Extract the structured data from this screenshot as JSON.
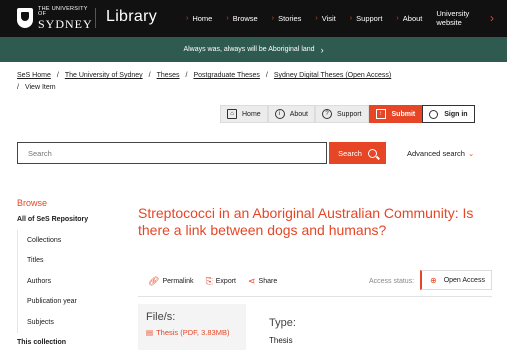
{
  "header": {
    "logo_small": "THE UNIVERSITY OF",
    "logo_big": "SYDNEY",
    "site_title": "Library",
    "nav": [
      "Home",
      "Browse",
      "Stories",
      "Visit",
      "Support",
      "About",
      "University website"
    ]
  },
  "banner": {
    "text": "Always was, always will be Aboriginal land"
  },
  "breadcrumb": [
    "SeS Home",
    "The University of Sydney",
    "Theses",
    "Postgraduate Theses",
    "Sydney Digital Theses (Open Access)",
    "View Item"
  ],
  "utility": {
    "home": "Home",
    "about": "About",
    "support": "Support",
    "submit": "Submit",
    "signin": "Sign in"
  },
  "search": {
    "placeholder": "Search",
    "button": "Search",
    "advanced": "Advanced search"
  },
  "sidebar": {
    "heading": "Browse",
    "group1": "All of SeS Repository",
    "items": [
      "Collections",
      "Titles",
      "Authors",
      "Publication year",
      "Subjects"
    ],
    "group2": "This collection"
  },
  "item": {
    "title": "Streptococci in an Aboriginal Australian Community: Is there a link between dogs and humans?",
    "actions": {
      "permalink": "Permalink",
      "export": "Export",
      "share": "Share"
    },
    "access_label": "Access status:",
    "access_value": "Open Access",
    "files_heading": "File/s:",
    "file_link": "Thesis (PDF, 3.83MB)",
    "type_heading": "Type:",
    "type_value": "Thesis"
  },
  "colors": {
    "accent": "#e64626",
    "header_bg": "#111111",
    "banner_bg": "#2f5a4f"
  }
}
